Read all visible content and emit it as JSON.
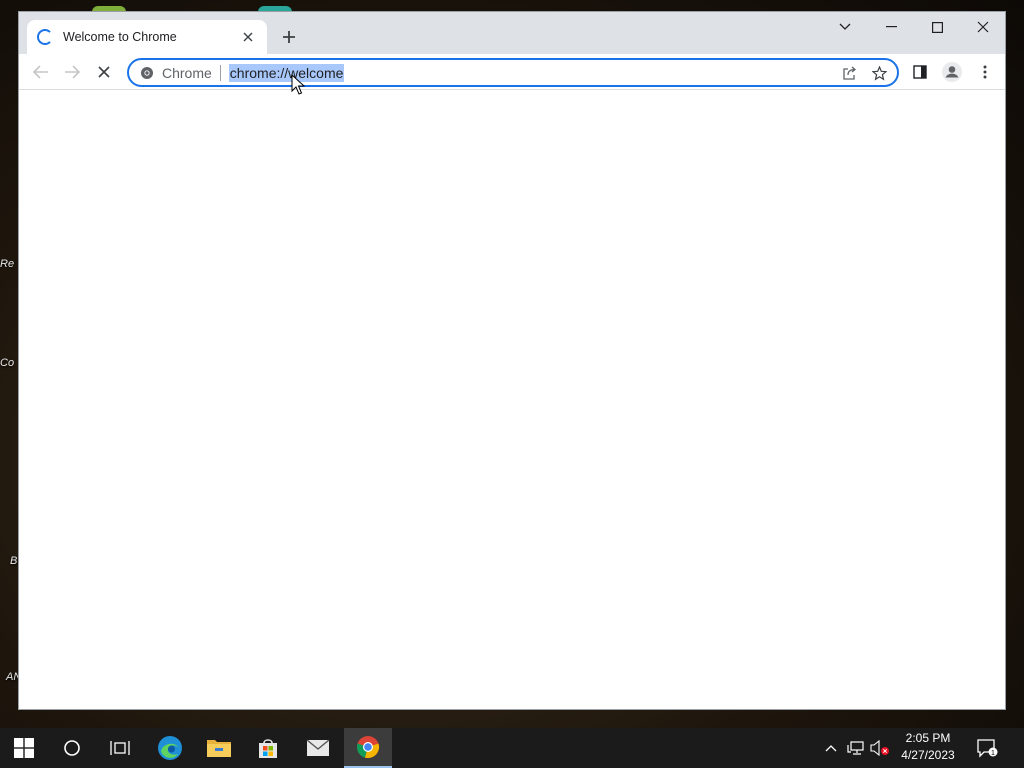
{
  "desktop": {
    "labels": [
      "Re",
      "Co",
      "B",
      "AN"
    ]
  },
  "browser": {
    "tab": {
      "title": "Welcome to Chrome",
      "close_symbol": "✕"
    },
    "new_tab_symbol": "+",
    "window_controls": {
      "tab_search_icon": "chevron-down-icon",
      "minimize_icon": "minimize-icon",
      "maximize_icon": "maximize-icon",
      "close_icon": "close-icon"
    },
    "omnibox": {
      "chip_label": "Chrome",
      "url": "chrome://welcome",
      "url_selected": true
    },
    "colors": {
      "accent": "#1a73e8",
      "selection": "#a8c7fa",
      "frame": "#dee1e6"
    }
  },
  "taskbar": {
    "items": [
      "start-icon",
      "search-icon",
      "task-view-icon",
      "edge-icon",
      "file-explorer-icon",
      "store-icon",
      "mail-icon",
      "chrome-icon"
    ],
    "active_item": "chrome-icon",
    "clock": {
      "time": "2:05 PM",
      "date": "4/27/2023"
    },
    "notification_count": "1"
  }
}
